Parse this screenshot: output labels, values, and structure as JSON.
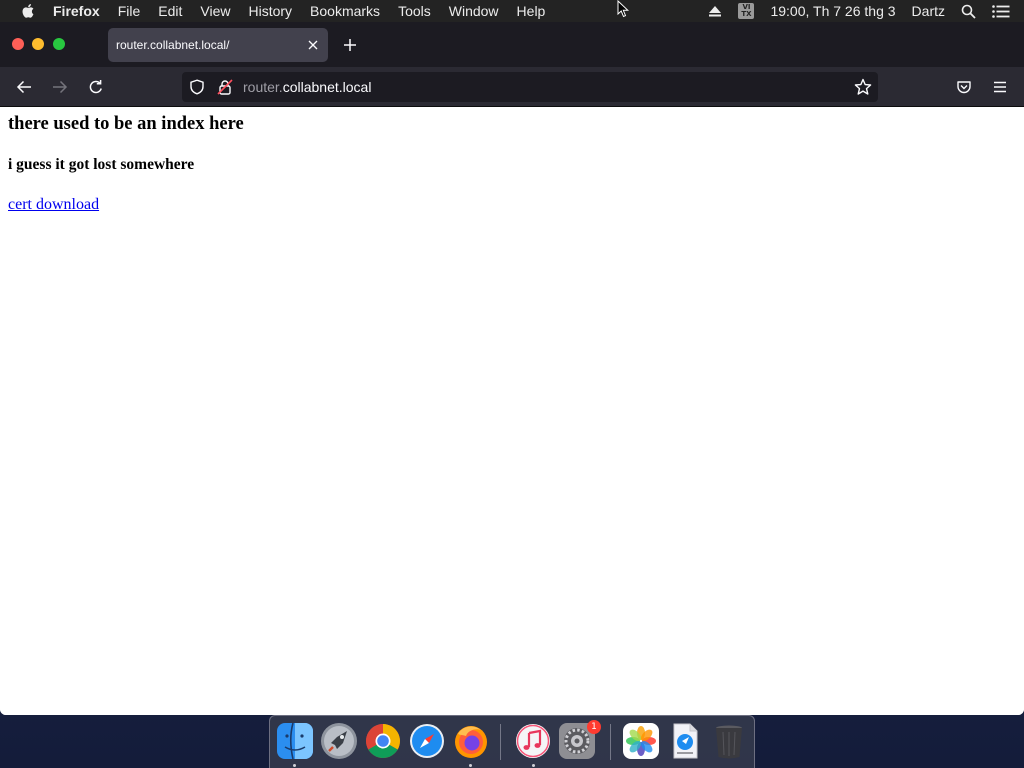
{
  "menubar": {
    "app_name": "Firefox",
    "items": [
      "File",
      "Edit",
      "View",
      "History",
      "Bookmarks",
      "Tools",
      "Window",
      "Help"
    ],
    "input_method": {
      "top": "VI",
      "bottom": "TX"
    },
    "clock": "19:00, Th 7 26 thg 3",
    "user": "Dartz"
  },
  "browser": {
    "tab_title": "router.collabnet.local/",
    "url_subdomain": "router.",
    "url_domain": "collabnet.local"
  },
  "page": {
    "heading": "there used to be an index here",
    "subheading": "i guess it got lost somewhere",
    "link_text": "cert download"
  },
  "dock": {
    "apps": [
      "finder-icon",
      "launchpad-icon",
      "chrome-icon",
      "safari-icon",
      "firefox-icon",
      "music-icon",
      "system-preferences-icon",
      "photos-icon",
      "downloads-icon",
      "trash-icon"
    ],
    "system_preferences_badge": "1"
  },
  "colors": {
    "link": "#0000ee",
    "tab_active": "#42414d",
    "toolbar": "#2b2a33",
    "tabbar": "#1c1b22"
  }
}
